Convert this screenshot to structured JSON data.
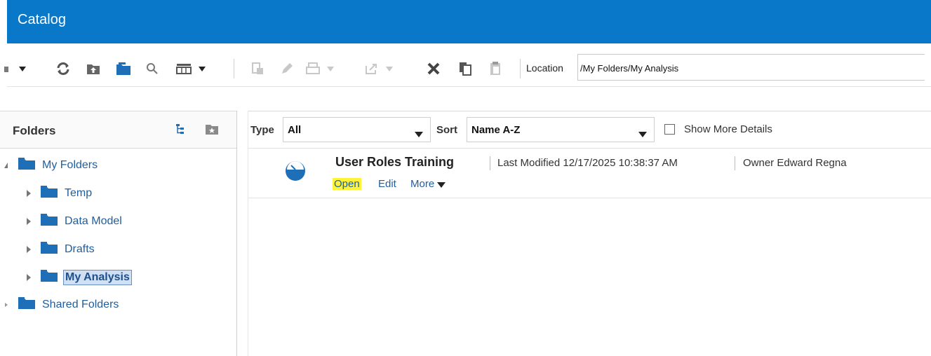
{
  "app": {
    "title": "Catalog"
  },
  "toolbar": {
    "location_label": "Location",
    "location_value": "/My Folders/My Analysis"
  },
  "folders_pane": {
    "title": "Folders",
    "tree": [
      {
        "label": "My Folders"
      },
      {
        "label": "Temp"
      },
      {
        "label": "Data Model"
      },
      {
        "label": "Drafts"
      },
      {
        "label": "My Analysis"
      },
      {
        "label": "Shared Folders"
      }
    ]
  },
  "filters": {
    "type_label": "Type",
    "type_value": "All",
    "sort_label": "Sort",
    "sort_value": "Name A-Z",
    "details_label": "Show More Details"
  },
  "items": [
    {
      "name": "User Roles Training",
      "modified": "Last Modified 12/17/2025 10:38:37 AM",
      "owner": "Owner Edward Regna",
      "actions": {
        "open": "Open",
        "edit": "Edit",
        "more": "More"
      }
    }
  ],
  "colors": {
    "header": "#0a78c8",
    "link": "#1f5e9e",
    "highlight": "#fff23a"
  }
}
